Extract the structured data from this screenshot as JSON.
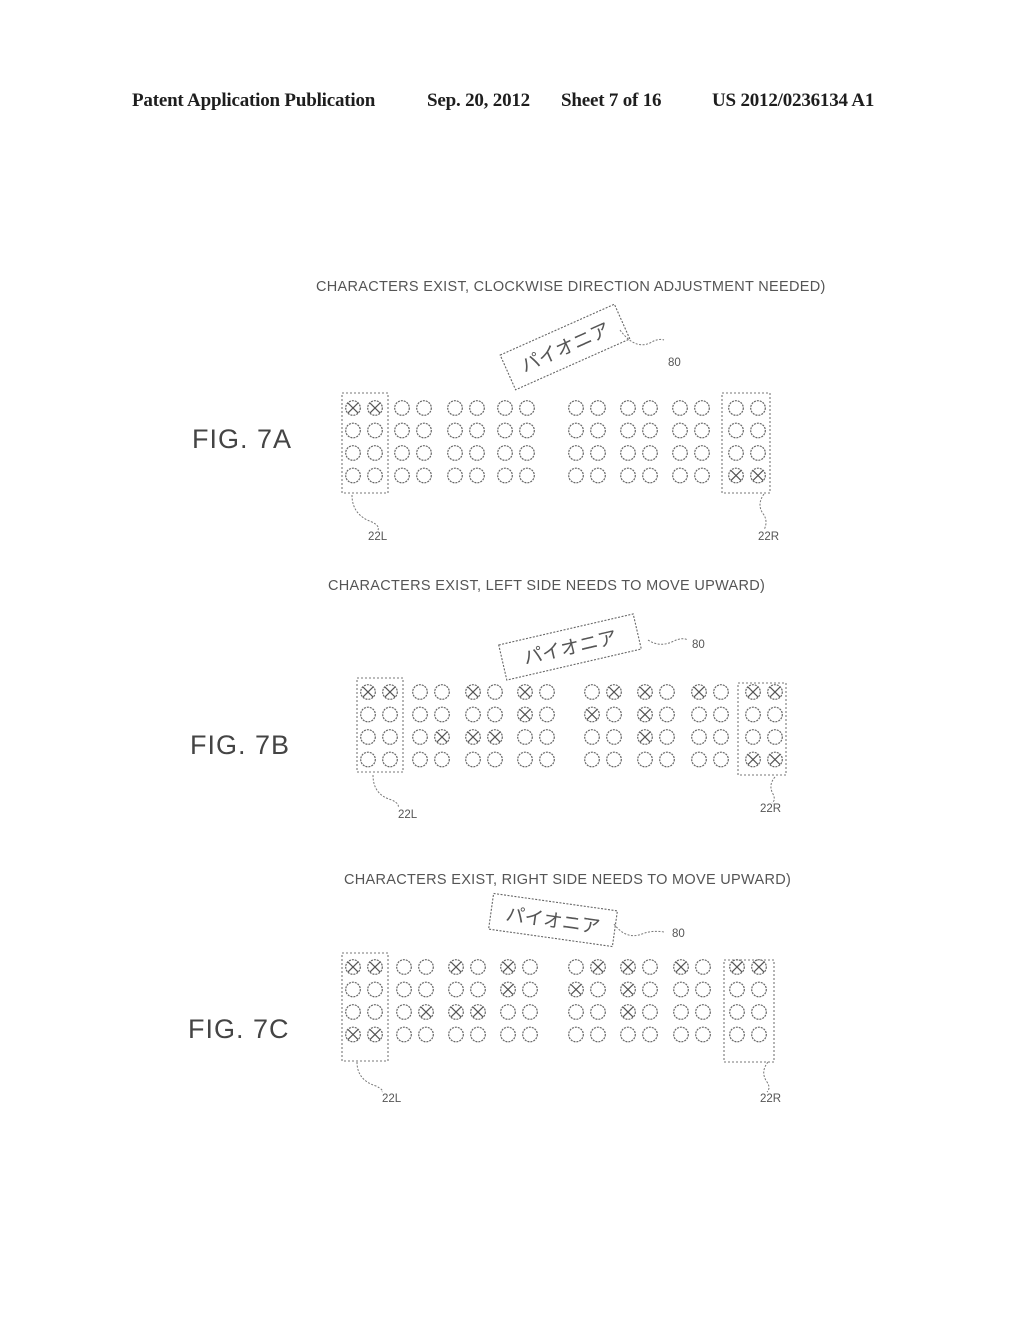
{
  "header": {
    "publication": "Patent Application Publication",
    "date": "Sep. 20, 2012",
    "sheet": "Sheet 7 of 16",
    "number": "US 2012/0236134 A1"
  },
  "figures": [
    {
      "id": "7A",
      "label": "FIG. 7A",
      "caption": "CHARACTERS EXIST, CLOCKWISE DIRECTION ADJUSTMENT NEEDED)",
      "text_object": "パイオニア",
      "text_ref": "80",
      "left_ref": "22L",
      "right_ref": "22R",
      "groups": [
        [
          [
            1,
            1
          ],
          [
            0,
            0
          ],
          [
            0,
            0
          ],
          [
            0,
            0
          ]
        ],
        [
          [
            0,
            0
          ],
          [
            0,
            0
          ],
          [
            0,
            0
          ],
          [
            0,
            0
          ]
        ],
        [
          [
            0,
            0
          ],
          [
            0,
            0
          ],
          [
            0,
            0
          ],
          [
            0,
            0
          ]
        ],
        [
          [
            0,
            0
          ],
          [
            0,
            0
          ],
          [
            0,
            0
          ],
          [
            0,
            0
          ]
        ],
        [
          [
            0,
            0
          ],
          [
            0,
            0
          ],
          [
            0,
            0
          ],
          [
            0,
            0
          ]
        ],
        [
          [
            0,
            0
          ],
          [
            0,
            0
          ],
          [
            0,
            0
          ],
          [
            0,
            0
          ]
        ],
        [
          [
            0,
            0
          ],
          [
            0,
            0
          ],
          [
            0,
            0
          ],
          [
            0,
            0
          ]
        ],
        [
          [
            0,
            0
          ],
          [
            0,
            0
          ],
          [
            0,
            0
          ],
          [
            1,
            1
          ]
        ]
      ]
    },
    {
      "id": "7B",
      "label": "FIG. 7B",
      "caption": "CHARACTERS EXIST, LEFT SIDE NEEDS TO MOVE UPWARD)",
      "text_object": "パイオニア",
      "text_ref": "80",
      "left_ref": "22L",
      "right_ref": "22R",
      "groups": [
        [
          [
            1,
            1
          ],
          [
            0,
            0
          ],
          [
            0,
            0
          ],
          [
            0,
            0
          ]
        ],
        [
          [
            0,
            0
          ],
          [
            0,
            0
          ],
          [
            0,
            1
          ],
          [
            0,
            0
          ]
        ],
        [
          [
            1,
            0
          ],
          [
            0,
            0
          ],
          [
            1,
            1
          ],
          [
            0,
            0
          ]
        ],
        [
          [
            1,
            0
          ],
          [
            1,
            0
          ],
          [
            0,
            0
          ],
          [
            0,
            0
          ]
        ],
        [
          [
            0,
            1
          ],
          [
            1,
            0
          ],
          [
            0,
            0
          ],
          [
            0,
            0
          ]
        ],
        [
          [
            1,
            0
          ],
          [
            1,
            0
          ],
          [
            1,
            0
          ],
          [
            0,
            0
          ]
        ],
        [
          [
            1,
            0
          ],
          [
            0,
            0
          ],
          [
            0,
            0
          ],
          [
            0,
            0
          ]
        ],
        [
          [
            1,
            1
          ],
          [
            0,
            0
          ],
          [
            0,
            0
          ],
          [
            1,
            1
          ]
        ]
      ]
    },
    {
      "id": "7C",
      "label": "FIG. 7C",
      "caption": "CHARACTERS EXIST, RIGHT SIDE NEEDS TO MOVE UPWARD)",
      "text_object": "パイオニア",
      "text_ref": "80",
      "left_ref": "22L",
      "right_ref": "22R",
      "groups": [
        [
          [
            1,
            1
          ],
          [
            0,
            0
          ],
          [
            0,
            0
          ],
          [
            1,
            1
          ]
        ],
        [
          [
            0,
            0
          ],
          [
            0,
            0
          ],
          [
            0,
            1
          ],
          [
            0,
            0
          ]
        ],
        [
          [
            1,
            0
          ],
          [
            0,
            0
          ],
          [
            1,
            1
          ],
          [
            0,
            0
          ]
        ],
        [
          [
            1,
            0
          ],
          [
            1,
            0
          ],
          [
            0,
            0
          ],
          [
            0,
            0
          ]
        ],
        [
          [
            0,
            1
          ],
          [
            1,
            0
          ],
          [
            0,
            0
          ],
          [
            0,
            0
          ]
        ],
        [
          [
            1,
            0
          ],
          [
            1,
            0
          ],
          [
            1,
            0
          ],
          [
            0,
            0
          ]
        ],
        [
          [
            1,
            0
          ],
          [
            0,
            0
          ],
          [
            0,
            0
          ],
          [
            0,
            0
          ]
        ],
        [
          [
            1,
            1
          ],
          [
            0,
            0
          ],
          [
            0,
            0
          ],
          [
            0,
            0
          ]
        ]
      ]
    }
  ]
}
